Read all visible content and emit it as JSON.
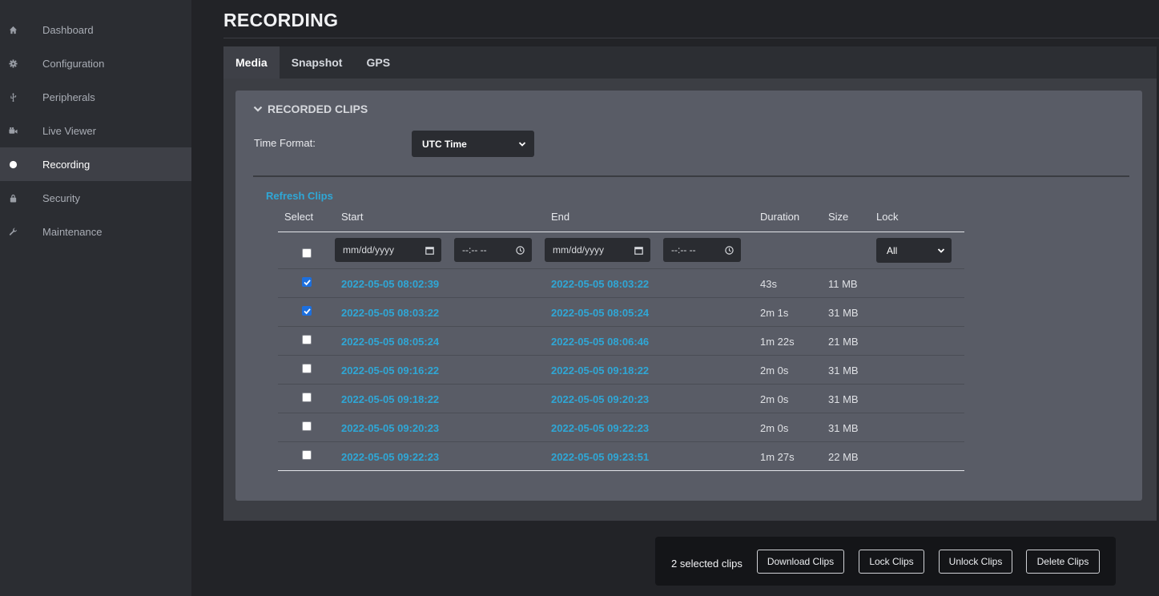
{
  "sidebar": {
    "items": [
      {
        "label": "Dashboard",
        "icon": "home-icon",
        "active": false
      },
      {
        "label": "Configuration",
        "icon": "gear-icon",
        "active": false
      },
      {
        "label": "Peripherals",
        "icon": "usb-icon",
        "active": false
      },
      {
        "label": "Live Viewer",
        "icon": "video-camera-icon",
        "active": false
      },
      {
        "label": "Recording",
        "icon": "record-dot-icon",
        "active": true
      },
      {
        "label": "Security",
        "icon": "lock-icon",
        "active": false
      },
      {
        "label": "Maintenance",
        "icon": "wrench-icon",
        "active": false
      }
    ]
  },
  "header": {
    "title": "RECORDING"
  },
  "tabs": [
    {
      "label": "Media",
      "active": true
    },
    {
      "label": "Snapshot",
      "active": false
    },
    {
      "label": "GPS",
      "active": false
    }
  ],
  "panel": {
    "title": "RECORDED CLIPS",
    "time_format_label": "Time Format:",
    "time_format_value": "UTC Time",
    "refresh_label": "Refresh Clips"
  },
  "table": {
    "headers": {
      "select": "Select",
      "start": "Start",
      "end": "End",
      "duration": "Duration",
      "size": "Size",
      "lock": "Lock"
    },
    "filters": {
      "start_date_placeholder": "mm/dd/yyyy",
      "start_time_placeholder": "--:-- --",
      "end_date_placeholder": "mm/dd/yyyy",
      "end_time_placeholder": "--:-- --",
      "lock_value": "All"
    },
    "rows": [
      {
        "checked": true,
        "start": "2022-05-05 08:02:39",
        "end": "2022-05-05 08:03:22",
        "duration": "43s",
        "size": "11 MB"
      },
      {
        "checked": true,
        "start": "2022-05-05 08:03:22",
        "end": "2022-05-05 08:05:24",
        "duration": "2m 1s",
        "size": "31 MB"
      },
      {
        "checked": false,
        "start": "2022-05-05 08:05:24",
        "end": "2022-05-05 08:06:46",
        "duration": "1m 22s",
        "size": "21 MB"
      },
      {
        "checked": false,
        "start": "2022-05-05 09:16:22",
        "end": "2022-05-05 09:18:22",
        "duration": "2m 0s",
        "size": "31 MB"
      },
      {
        "checked": false,
        "start": "2022-05-05 09:18:22",
        "end": "2022-05-05 09:20:23",
        "duration": "2m 0s",
        "size": "31 MB"
      },
      {
        "checked": false,
        "start": "2022-05-05 09:20:23",
        "end": "2022-05-05 09:22:23",
        "duration": "2m 0s",
        "size": "31 MB"
      },
      {
        "checked": false,
        "start": "2022-05-05 09:22:23",
        "end": "2022-05-05 09:23:51",
        "duration": "1m 27s",
        "size": "22 MB"
      }
    ]
  },
  "actions": {
    "selected_text": "2 selected clips",
    "download_label": "Download Clips",
    "lock_label": "Lock Clips",
    "unlock_label": "Unlock Clips",
    "delete_label": "Delete Clips"
  },
  "colors": {
    "accent_link": "#2fa7d6",
    "checkbox_checked": "#1c6fde",
    "sidebar_bg": "#2b2d32",
    "panel_bg": "#595c66"
  }
}
